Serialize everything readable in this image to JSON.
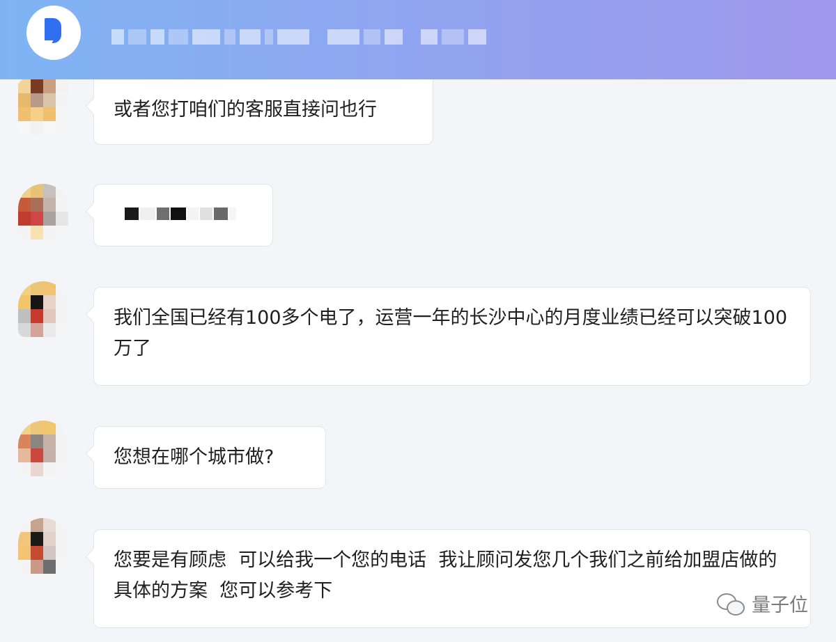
{
  "header": {
    "app_icon": "document-icon"
  },
  "messages": [
    {
      "text": "或者您打咱们的客服直接问也行"
    },
    {
      "redacted": true
    },
    {
      "text": "我们全国已经有100多个电了，运营一年的长沙中心的月度业绩已经可以突破100万了"
    },
    {
      "text": "您想在哪个城市做?"
    },
    {
      "text": "您要是有顾虑  可以给我一个您的电话  我让顾问发您几个我们之前给加盟店做的具体的方案  您可以参考下"
    }
  ],
  "watermark": {
    "icon": "wechat-icon",
    "text": "量子位"
  },
  "colors": {
    "header_gradient_start": "#7fb4f4",
    "header_gradient_end": "#9f98ee",
    "logo_blue": "#2f6ff0",
    "bubble_bg": "#ffffff",
    "page_bg": "#f4f5f8"
  }
}
